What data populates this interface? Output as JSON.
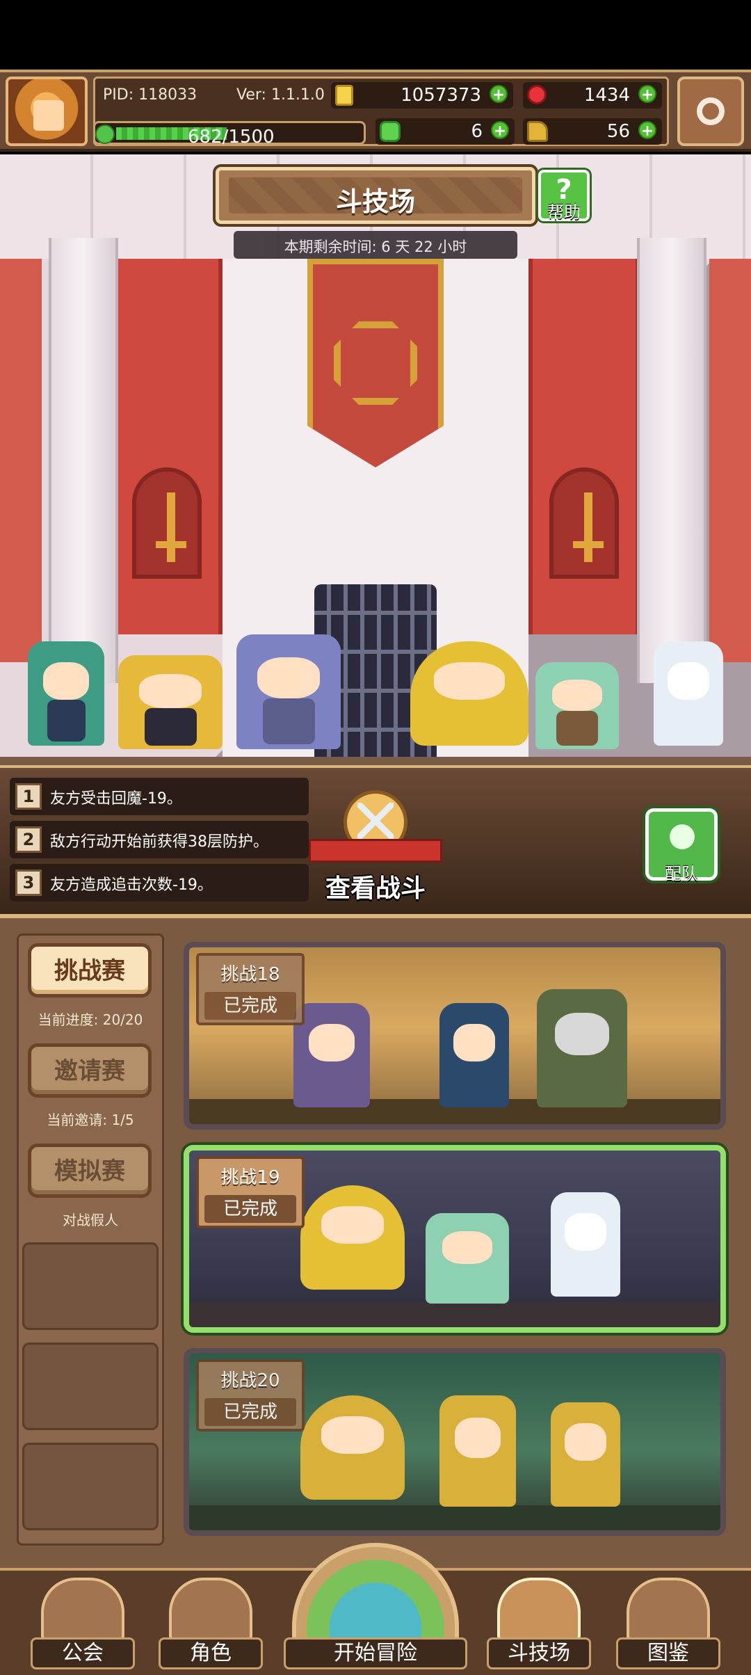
{
  "header": {
    "pid": "PID: 118033",
    "version": "Ver: 1.1.1.0",
    "gold": "1057373",
    "gems": "1434",
    "energy": "682/1500",
    "energy_fraction": 0.455,
    "clover": "6",
    "keys": "56"
  },
  "arena": {
    "title": "斗技场",
    "help_label": "帮助",
    "help_symbol": "?",
    "timer": "本期剩余时间: 6 天 22 小时"
  },
  "rules": [
    {
      "num": "1",
      "text": "友方受击回魔-19。"
    },
    {
      "num": "2",
      "text": "敌方行动开始前获得38层防护。"
    },
    {
      "num": "3",
      "text": "友方造成追击次数-19。"
    }
  ],
  "view_battle_label": "查看战斗",
  "team_label": "配队",
  "sidebar": {
    "challenge": "挑战赛",
    "challenge_progress": "当前进度: 20/20",
    "invite": "邀请赛",
    "invite_progress": "当前邀请: 1/5",
    "sim": "模拟赛",
    "sim_sub": "对战假人"
  },
  "cards": [
    {
      "title": "挑战18",
      "status": "已完成"
    },
    {
      "title": "挑战19",
      "status": "已完成"
    },
    {
      "title": "挑战20",
      "status": "已完成"
    }
  ],
  "nav": {
    "guild": "公会",
    "character": "角色",
    "adventure": "开始冒险",
    "arena": "斗技场",
    "codex": "图鉴"
  },
  "colors": {
    "accent_green": "#52c234",
    "gold_border": "#c9a06a",
    "selected_card": "#93e06d"
  }
}
